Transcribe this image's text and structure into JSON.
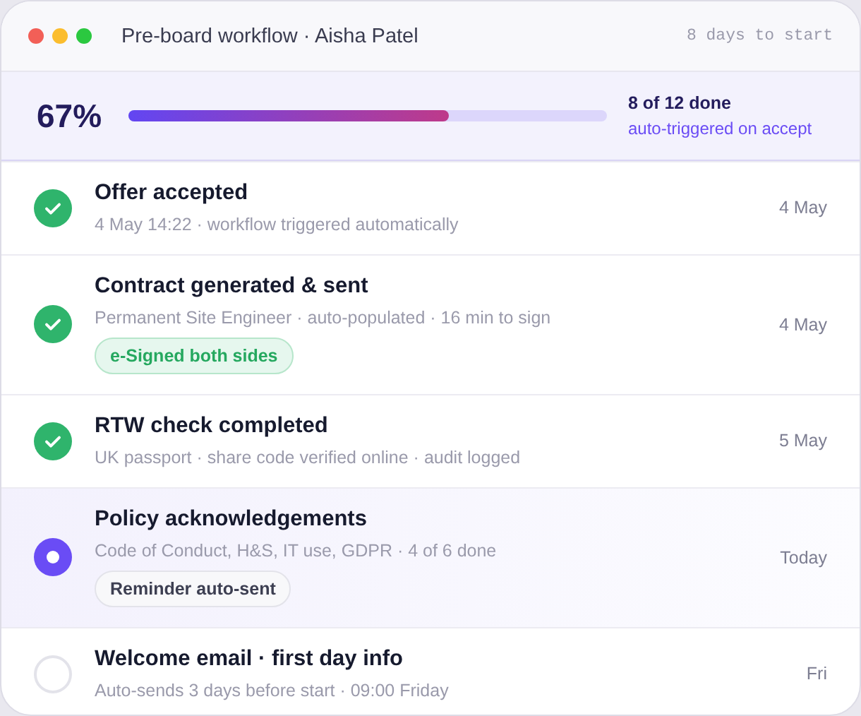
{
  "window": {
    "title": "Pre-board workflow · Aisha Patel",
    "countdown": "8 days to start"
  },
  "progress": {
    "percent": "67%",
    "level": 0.67,
    "count": "8 of 12 done",
    "note": "auto-triggered on accept"
  },
  "steps": [
    {
      "title": "Offer accepted",
      "detail": "4 May 14:22 · workflow triggered automatically",
      "date": "4 May",
      "kind": "done"
    },
    {
      "title": "Contract generated & sent",
      "detail": "Permanent Site Engineer · auto-populated · 16 min to sign",
      "date": "4 May",
      "kind": "done",
      "tag": {
        "label": "e-Signed both sides",
        "kind": "success"
      }
    },
    {
      "title": "RTW check completed",
      "detail": "UK passport · share code verified online · audit logged",
      "date": "5 May",
      "kind": "done"
    },
    {
      "title": "Policy acknowledgements",
      "detail": "Code of Conduct, H&S, IT use, GDPR · 4 of 6 done",
      "date": "Today",
      "kind": "current",
      "tag": {
        "label": "Reminder auto-sent",
        "kind": "neutral"
      }
    },
    {
      "title": "Welcome email · first day info",
      "detail": "Auto-sends 3 days before start · 09:00 Friday",
      "date": "Fri",
      "kind": "pending"
    }
  ]
}
